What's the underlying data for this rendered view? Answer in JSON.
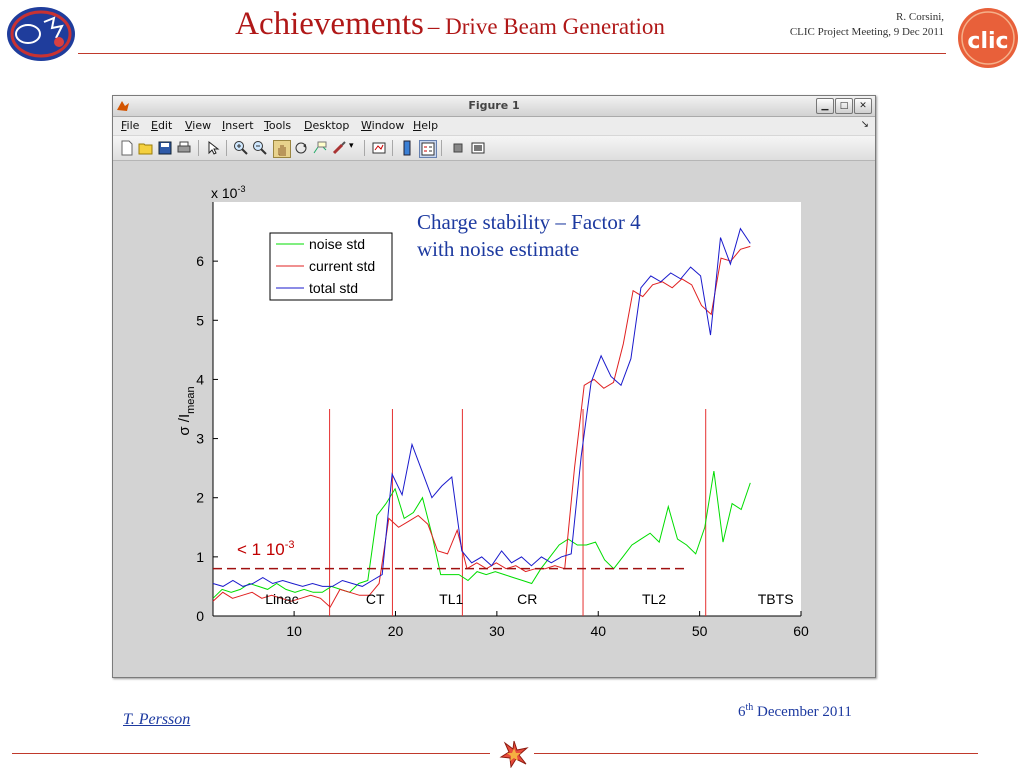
{
  "slide": {
    "title_main": "Achievements",
    "title_sub": "– Drive Beam Generation",
    "meta_line1": "R. Corsini,",
    "meta_line2": "CLIC Project Meeting, 9 Dec 2011",
    "logo_right_text": "clic",
    "author": "T. Persson",
    "date_prefix": "6",
    "date_sup": "th",
    "date_rest": " December 2011"
  },
  "colors": {
    "accent": "#b01818",
    "rule": "#c0392b",
    "link_blue": "#1d3aa0"
  },
  "window": {
    "title": "Figure 1",
    "menus": [
      "File",
      "Edit",
      "View",
      "Insert",
      "Tools",
      "Desktop",
      "Window",
      "Help"
    ],
    "toolbar_icons": [
      "new-figure-icon",
      "open-file-icon",
      "save-icon",
      "print-icon",
      "pointer-icon",
      "zoom-in-icon",
      "zoom-out-icon",
      "pan-icon",
      "rotate-icon",
      "data-cursor-icon",
      "brush-icon",
      "link-plot-icon",
      "colorbar-icon",
      "legend-icon",
      "hide-plot-tools-icon",
      "show-plot-tools-icon"
    ],
    "controls": [
      "minimize",
      "maximize",
      "close"
    ]
  },
  "chart_data": {
    "type": "line",
    "xlim": [
      2,
      60
    ],
    "ylim": [
      0,
      7
    ],
    "xticks": [
      10,
      20,
      30,
      40,
      50,
      60
    ],
    "yticks": [
      0,
      1,
      2,
      3,
      4,
      5,
      6
    ],
    "y_exponent_label": "x 10",
    "y_exponent_sup": "-3",
    "ylabel_main": "σ /I",
    "ylabel_sub": "mean",
    "annotation_title_line1": "Charge stability – Factor 4",
    "annotation_title_line2": "with noise estimate",
    "threshold": {
      "value": 0.8,
      "label": "< 1 10",
      "label_sup": "-3"
    },
    "section_boundaries": [
      13.5,
      19.7,
      26.6,
      38.5,
      50.6
    ],
    "sections": [
      {
        "name": "Linac",
        "x": 8.8
      },
      {
        "name": "CT",
        "x": 18
      },
      {
        "name": "TL1",
        "x": 25.5
      },
      {
        "name": "CR",
        "x": 33
      },
      {
        "name": "TL2",
        "x": 45.5
      },
      {
        "name": "TBTS",
        "x": 57.5
      }
    ],
    "grid": false,
    "legend_position": "top-left",
    "x": [
      2,
      3,
      4,
      5,
      6,
      7,
      8,
      9,
      10,
      11,
      12,
      13,
      14,
      15,
      16,
      17,
      18,
      19,
      20,
      21,
      22,
      23,
      24,
      25,
      26,
      27,
      28,
      29,
      30,
      31,
      32,
      33,
      34,
      35,
      36,
      37,
      38,
      39,
      40,
      41,
      42,
      43,
      44,
      45,
      46,
      47,
      48,
      49,
      50,
      51,
      52,
      53,
      54,
      55
    ],
    "series": [
      {
        "name": "noise std",
        "color": "#00dd00",
        "values": [
          0.3,
          0.45,
          0.4,
          0.45,
          0.55,
          0.5,
          0.45,
          0.55,
          0.45,
          0.4,
          0.45,
          0.4,
          0.4,
          0.5,
          0.45,
          0.4,
          0.55,
          0.6,
          1.7,
          1.9,
          2.15,
          1.65,
          1.75,
          2.0,
          1.4,
          0.7,
          0.7,
          0.7,
          0.6,
          0.75,
          0.7,
          0.75,
          0.7,
          0.65,
          0.6,
          0.55,
          0.8,
          1.0,
          1.2,
          1.3,
          1.2,
          1.2,
          1.25,
          0.95,
          0.8,
          1.0,
          1.2,
          1.3,
          1.4,
          1.25,
          1.85,
          1.3,
          1.2,
          1.05,
          1.5,
          2.45,
          1.25,
          1.9,
          1.8,
          2.25
        ]
      },
      {
        "name": "current std",
        "color": "#e02020",
        "values": [
          0.25,
          0.4,
          0.3,
          0.35,
          0.4,
          0.3,
          0.35,
          0.3,
          0.25,
          0.3,
          0.35,
          0.3,
          0.15,
          0.45,
          0.4,
          0.35,
          0.35,
          0.55,
          1.65,
          1.5,
          1.6,
          1.7,
          1.55,
          1.1,
          1.05,
          1.45,
          0.8,
          0.9,
          0.8,
          0.9,
          0.8,
          0.85,
          0.75,
          0.8,
          0.8,
          0.85,
          0.8,
          2.5,
          3.9,
          4.0,
          3.85,
          3.95,
          4.6,
          5.5,
          5.4,
          5.6,
          5.65,
          5.55,
          5.7,
          5.6,
          5.25,
          5.1,
          6.05,
          6.0,
          6.2,
          6.25
        ]
      },
      {
        "name": "total std",
        "color": "#1a1acc",
        "values": [
          0.55,
          0.5,
          0.6,
          0.5,
          0.55,
          0.65,
          0.55,
          0.6,
          0.55,
          0.5,
          0.55,
          0.5,
          0.5,
          0.6,
          0.55,
          0.5,
          0.6,
          0.7,
          2.4,
          2.05,
          2.9,
          2.45,
          2.0,
          2.2,
          2.35,
          1.1,
          0.9,
          1.0,
          0.85,
          1.1,
          0.9,
          1.0,
          0.85,
          1.0,
          0.9,
          1.0,
          1.05,
          2.7,
          3.95,
          4.4,
          4.05,
          3.9,
          4.35,
          5.55,
          5.75,
          5.65,
          5.8,
          5.7,
          5.9,
          5.75,
          4.75,
          6.4,
          5.95,
          6.55,
          6.3
        ]
      }
    ]
  }
}
